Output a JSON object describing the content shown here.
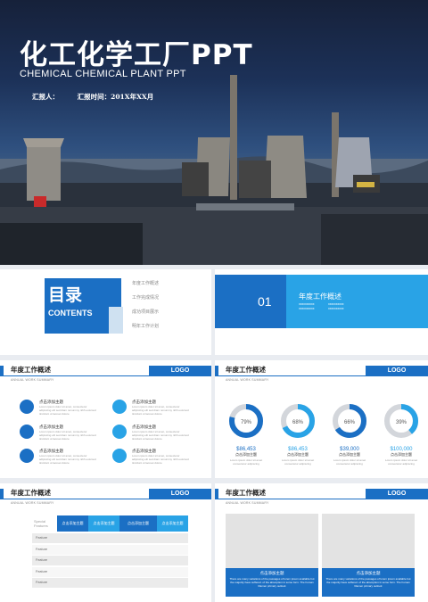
{
  "cover": {
    "title": "化工化学工厂PPT",
    "subtitle": "CHEMICAL CHEMICAL PLANT PPT",
    "reporter": "汇报人：",
    "time": "汇报时间：201X年XX月"
  },
  "toc": {
    "title": "目录",
    "subtitle": "CONTENTS",
    "items": [
      "年度工作概述",
      "工作完成情况",
      "成功项目展示",
      "明年工作计划"
    ]
  },
  "section": {
    "number": "01",
    "title": "年度工作概述",
    "lines": [
      "xxxxxxxxxx",
      "xxxxxxxxxx",
      "xxxxxxxxxx",
      "xxxxxxxxxx"
    ]
  },
  "header": {
    "title": "年度工作概述",
    "subtitle": "ANNUAL  WORK SUMMARY",
    "logo": "LOGO"
  },
  "slide_a": {
    "items": [
      {
        "title": "点击添加主题"
      },
      {
        "title": "点击添加主题"
      },
      {
        "title": "点击添加主题"
      },
      {
        "title": "点击添加主题"
      },
      {
        "title": "点击添加主题"
      },
      {
        "title": "点击添加主题"
      }
    ],
    "body": "Lorem ipsum dolor sit amet, consectetur adipiscing elit sed diam nonummy nibh euismod tincidunt ut laoreet dolore"
  },
  "slide_b": {
    "stats": [
      {
        "pct": "79%",
        "value": "$86,453",
        "label": "点击添加主题",
        "color": "#1b6fc4"
      },
      {
        "pct": "68%",
        "value": "$86,453",
        "label": "点击添加主题",
        "color": "#29a3e6"
      },
      {
        "pct": "66%",
        "value": "$39,000",
        "label": "点击添加主题",
        "color": "#1b6fc4"
      },
      {
        "pct": "39%",
        "value": "$100,000",
        "label": "点击添加主题",
        "color": "#29a3e6"
      }
    ],
    "desc": "Lorem ipsum dolor sit amet consectetur adipiscing"
  },
  "slide_c": {
    "corner": "Special Features",
    "headers": [
      "点击添加主题",
      "点击添加主题",
      "点击添加主题",
      "点击添加主题"
    ],
    "rows": [
      "Feature",
      "Feature",
      "Feature",
      "Feature",
      "Feature"
    ]
  },
  "slide_d": {
    "cards": [
      {
        "title": "点击添加主题",
        "text": "There are many variations of the passages of lorem ipsum available but the majority have suffered. of the absorption in some form. The human Ramen primary outlook"
      },
      {
        "title": "点击添加主题",
        "text": "There are many variations of the passages of lorem ipsum available but the majority have suffered. of the absorption in some form. The human Ramen primary outlook"
      }
    ]
  }
}
